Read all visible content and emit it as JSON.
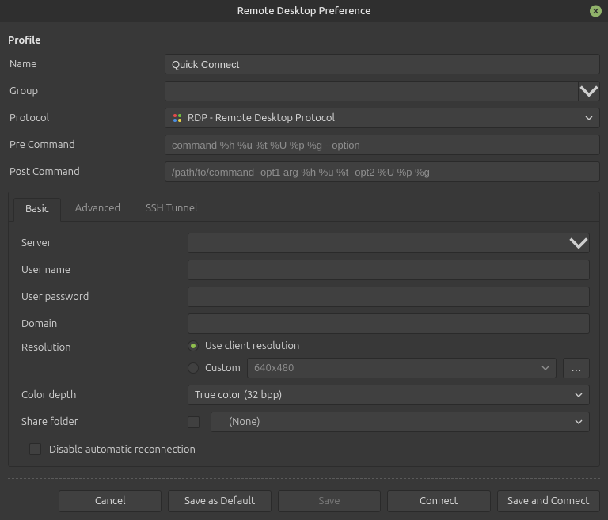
{
  "window": {
    "title": "Remote Desktop Preference"
  },
  "profile": {
    "heading": "Profile",
    "name_label": "Name",
    "name_value": "Quick Connect",
    "group_label": "Group",
    "group_value": "",
    "protocol_label": "Protocol",
    "protocol_value": "RDP - Remote Desktop Protocol",
    "precmd_label": "Pre Command",
    "precmd_placeholder": "command %h %u %t %U %p %g --option",
    "postcmd_label": "Post Command",
    "postcmd_placeholder": "/path/to/command -opt1 arg %h %u %t -opt2 %U %p %g"
  },
  "tabs": {
    "basic": "Basic",
    "advanced": "Advanced",
    "ssh": "SSH Tunnel"
  },
  "basic": {
    "server_label": "Server",
    "server_value": "",
    "username_label": "User name",
    "username_value": "",
    "password_label": "User password",
    "password_value": "",
    "domain_label": "Domain",
    "domain_value": "",
    "resolution_label": "Resolution",
    "res_client": "Use client resolution",
    "res_custom_label": "Custom",
    "res_custom_value": "640x480",
    "color_label": "Color depth",
    "color_value": "True color (32 bpp)",
    "share_label": "Share folder",
    "share_value": "(None)",
    "disable_reconnect": "Disable automatic reconnection"
  },
  "buttons": {
    "cancel": "Cancel",
    "save_default": "Save as Default",
    "save": "Save",
    "connect": "Connect",
    "save_connect": "Save and Connect"
  }
}
